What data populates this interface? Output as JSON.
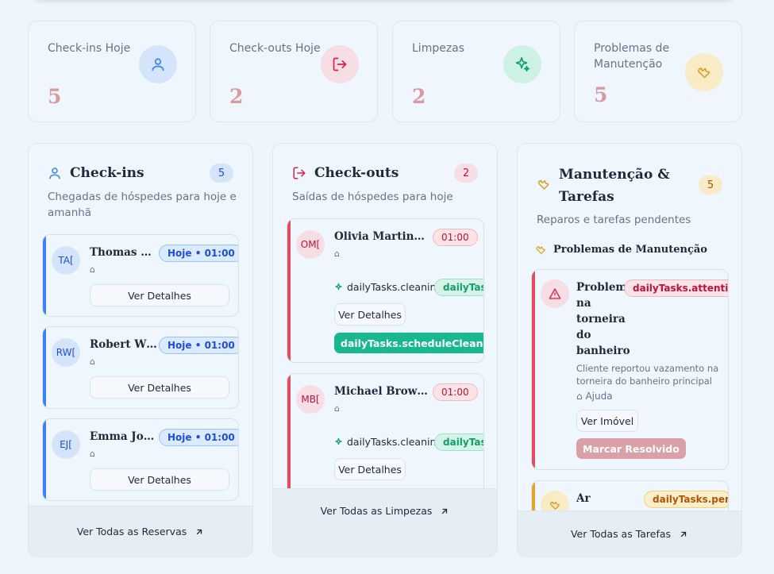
{
  "stats": [
    {
      "label": "Check-ins Hoje",
      "value": "5",
      "icon": "user-icon",
      "color": "#3b82f6",
      "bg": "#d4e5fb"
    },
    {
      "label": "Check-outs Hoje",
      "value": "2",
      "icon": "logout-icon",
      "color": "#e11d48",
      "bg": "#f7dde4"
    },
    {
      "label": "Limpezas",
      "value": "2",
      "icon": "sparkles-icon",
      "color": "#0f9e6e",
      "bg": "#cdf1e4"
    },
    {
      "label": "Problemas de Manutenção",
      "value": "5",
      "icon": "wrench-icon",
      "color": "#d99a0b",
      "bg": "#f8ebc6"
    }
  ],
  "checkins": {
    "title": "Check-ins",
    "count": "5",
    "subtitle": "Chegadas de hóspedes para hoje e amanhã",
    "items": [
      {
        "initials": "TA[",
        "name": "Thomas An...",
        "badge": "Hoje • 01:00",
        "button": "Ver Detalhes"
      },
      {
        "initials": "RW[",
        "name": "Robert Wils...",
        "badge": "Hoje • 01:00",
        "button": "Ver Detalhes"
      },
      {
        "initials": "EJ[",
        "name": "Emma John...",
        "badge": "Hoje • 01:00",
        "button": "Ver Detalhes"
      }
    ],
    "footer": "Ver Todas as Reservas"
  },
  "checkouts": {
    "title": "Check-outs",
    "count": "2",
    "subtitle": "Saídas de hóspedes para hoje",
    "items": [
      {
        "initials": "OM[",
        "name": "Olivia Martinez [...",
        "time": "01:00",
        "task": "dailyTasks.cleaning",
        "task_badge": "dailyTask",
        "button": "Ver Detalhes",
        "action": "dailyTasks.scheduleClean"
      },
      {
        "initials": "MB[",
        "name": "Michael Brown [...",
        "time": "01:00",
        "task": "dailyTasks.cleaning",
        "task_badge": "dailyTask",
        "button": "Ver Detalhes"
      }
    ],
    "footer": "Ver Todas as Limpezas"
  },
  "maintenance": {
    "title_line1": "Manutenção &",
    "title_line2": "Tarefas",
    "count": "5",
    "subtitle": "Reparos e tarefas pendentes",
    "section": "Problemas de Manutenção",
    "issue": {
      "title_lines": [
        "Problema",
        "na",
        "torneira",
        "do",
        "banheiro"
      ],
      "badge": "dailyTasks.attentionS",
      "description": "Cliente reportou vazamento na torneira do banheiro principal",
      "property": "Ajuda",
      "view_button": "Ver Imóvel",
      "resolve_button": "Marcar Resolvido"
    },
    "next": {
      "title": "Ar",
      "badge": "dailyTasks.pendi"
    },
    "footer": "Ver Todas as Tarefas"
  }
}
